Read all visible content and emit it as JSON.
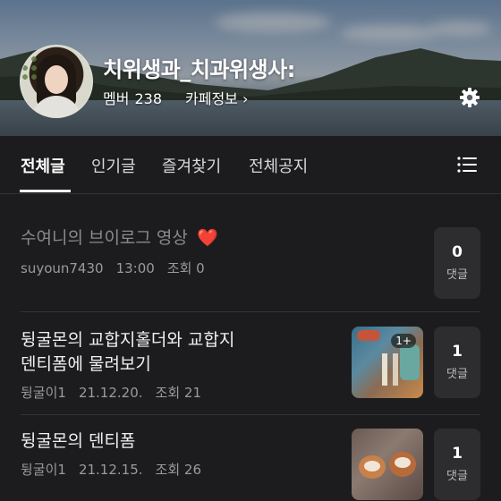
{
  "header": {
    "cafe_title": "치위생과_치과위생사:",
    "member_label": "멤버",
    "member_count": "238",
    "cafe_info": "카페정보 ›"
  },
  "tabs": [
    {
      "label": "전체글",
      "active": true
    },
    {
      "label": "인기글",
      "active": false
    },
    {
      "label": "즐겨찾기",
      "active": false
    },
    {
      "label": "전체공지",
      "active": false
    }
  ],
  "posts": [
    {
      "title": "수여니의 브이로그 영상",
      "emoji": "❤️",
      "author": "suyoun7430",
      "date": "13:00",
      "views": "조회 0",
      "comments": "0",
      "comments_label": "댓글",
      "has_thumb": false
    },
    {
      "title_line1": "뒹굴몬의 교합지홀더와 교합지",
      "title_line2": "덴티폼에 물려보기",
      "author": "뒹굴이1",
      "date": "21.12.20.",
      "views": "조회 21",
      "comments": "1",
      "comments_label": "댓글",
      "thumb_badge": "1+",
      "has_thumb": true
    },
    {
      "title": "뒹굴몬의 덴티폼",
      "author": "뒹굴이1",
      "date": "21.12.15.",
      "views": "조회 26",
      "comments": "1",
      "comments_label": "댓글",
      "has_thumb": true
    }
  ],
  "icons": {
    "settings": "gear-icon",
    "menu": "list-menu-icon"
  },
  "colors": {
    "background": "#1c1c1e",
    "comment_box": "#2d2d30",
    "text_primary": "#f0f0f0",
    "text_secondary": "#9a9a9a",
    "heart": "#e02b2b"
  }
}
